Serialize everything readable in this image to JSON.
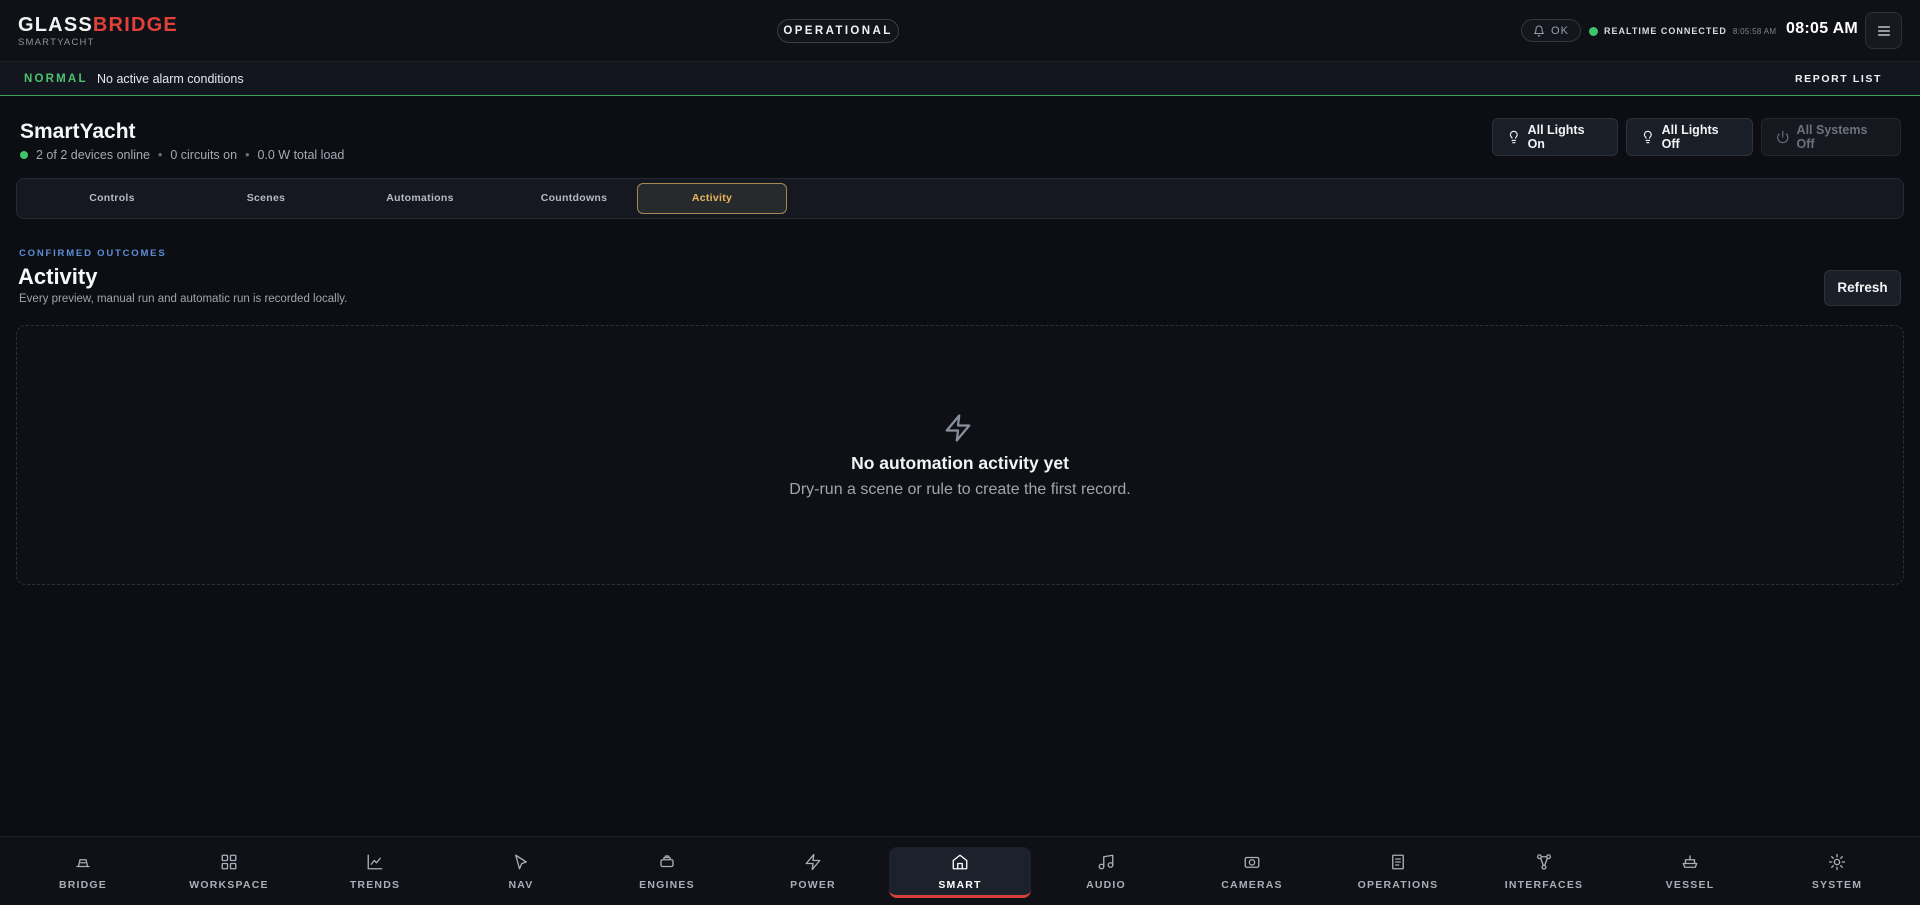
{
  "brand": {
    "name_part1": "GLASS",
    "name_part2": "BRIDGE",
    "subtitle": "SMARTYACHT"
  },
  "status": {
    "mode": "OPERATIONAL",
    "alarm_badge": "OK",
    "connection": "REALTIME CONNECTED",
    "last_update": "8:05:58 AM",
    "clock": "08:05 AM"
  },
  "alarm_banner": {
    "level": "NORMAL",
    "message": "No active alarm conditions",
    "report_label": "REPORT LIST",
    "color": "#4cc46e"
  },
  "page": {
    "title": "SmartYacht",
    "summary": {
      "devices": "2 of 2 devices online",
      "circuits": "0 circuits on",
      "load": "0.0 W total load",
      "separator": "•"
    }
  },
  "quick_actions": {
    "lights_on": "All Lights On",
    "lights_off": "All Lights Off",
    "systems_off": "All Systems Off"
  },
  "tabs": [
    "Controls",
    "Scenes",
    "Automations",
    "Countdowns",
    "Activity"
  ],
  "active_tab": "Activity",
  "activity": {
    "eyebrow": "CONFIRMED OUTCOMES",
    "title": "Activity",
    "description": "Every preview, manual run and automatic run is recorded locally.",
    "refresh_label": "Refresh",
    "empty_icon": "lightning-icon",
    "empty_title": "No automation activity yet",
    "empty_subtitle": "Dry-run a scene or rule to create the first record."
  },
  "nav": [
    {
      "label": "BRIDGE",
      "icon": "helm-icon"
    },
    {
      "label": "WORKSPACE",
      "icon": "grid-icon"
    },
    {
      "label": "TRENDS",
      "icon": "chart-icon"
    },
    {
      "label": "NAV",
      "icon": "navigation-icon"
    },
    {
      "label": "ENGINES",
      "icon": "engine-icon"
    },
    {
      "label": "POWER",
      "icon": "lightning-icon"
    },
    {
      "label": "SMART",
      "icon": "home-icon"
    },
    {
      "label": "AUDIO",
      "icon": "music-icon"
    },
    {
      "label": "CAMERAS",
      "icon": "camera-icon"
    },
    {
      "label": "OPERATIONS",
      "icon": "document-icon"
    },
    {
      "label": "INTERFACES",
      "icon": "network-icon"
    },
    {
      "label": "VESSEL",
      "icon": "ship-icon"
    },
    {
      "label": "SYSTEM",
      "icon": "gear-icon"
    }
  ],
  "active_nav": "SMART",
  "colors": {
    "background": "#0c0e13",
    "accent_red": "#e0413a",
    "accent_amber": "#e9b75b",
    "status_green": "#3ec46d",
    "eyebrow_blue": "#5d8ed8"
  }
}
